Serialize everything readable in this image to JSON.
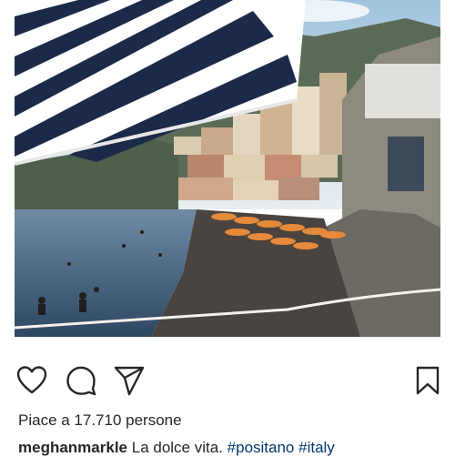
{
  "post": {
    "image_alt": "Positano beach with striped umbrella",
    "likes_text": "Piace a 17.710 persone",
    "caption": {
      "username": "meghanmarkle",
      "text": "La dolce vita.",
      "hashtags": [
        "#positano",
        "#italy"
      ]
    }
  },
  "actions": {
    "like_icon": "heart-icon",
    "comment_icon": "comment-icon",
    "share_icon": "paper-plane-icon",
    "save_icon": "bookmark-icon"
  },
  "colors": {
    "text": "#262626",
    "hashtag": "#00376b",
    "umbrella_navy": "#1c2a4a",
    "sea": "#3b5a7a",
    "beach_umbrella_orange": "#e58a3a"
  }
}
